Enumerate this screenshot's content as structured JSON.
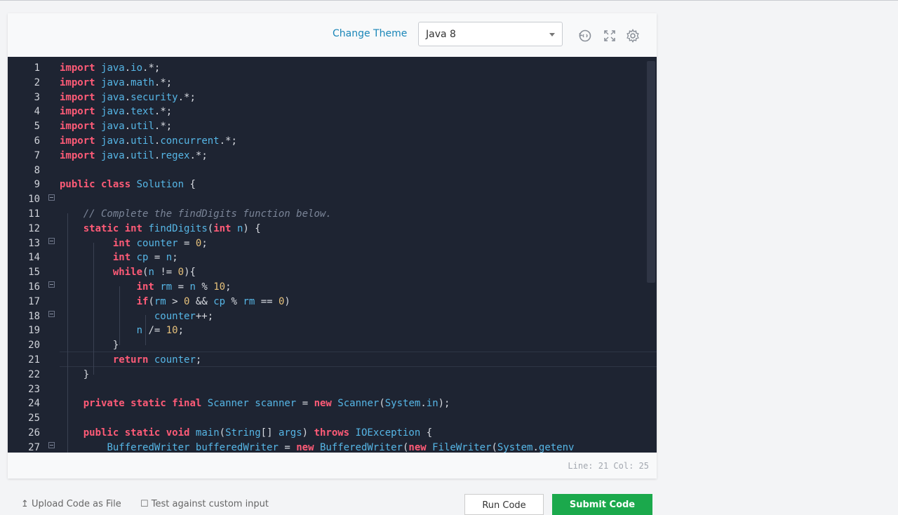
{
  "toolbar": {
    "change_theme": "Change Theme",
    "language": "Java 8",
    "icons": [
      "history-icon",
      "fullscreen-icon",
      "settings-gear-icon"
    ]
  },
  "editor": {
    "line_numbers": [
      "1",
      "2",
      "3",
      "4",
      "5",
      "6",
      "7",
      "8",
      "9",
      "10",
      "11",
      "12",
      "13",
      "14",
      "15",
      "16",
      "17",
      "18",
      "19",
      "20",
      "21",
      "22",
      "23",
      "24",
      "25",
      "26",
      "27"
    ],
    "status": "Line: 21 Col: 25"
  },
  "footer": {
    "upload": "Upload Code as File",
    "custom_input": "Test against custom input",
    "run": "Run Code",
    "submit": "Submit Code"
  },
  "colors": {
    "editor_bg": "#1e2432",
    "keyword": "#ff5b77",
    "identifier": "#56b6e6",
    "number": "#e5c07b",
    "submit_green": "#1ba94c",
    "link_blue": "#1a86b8"
  }
}
